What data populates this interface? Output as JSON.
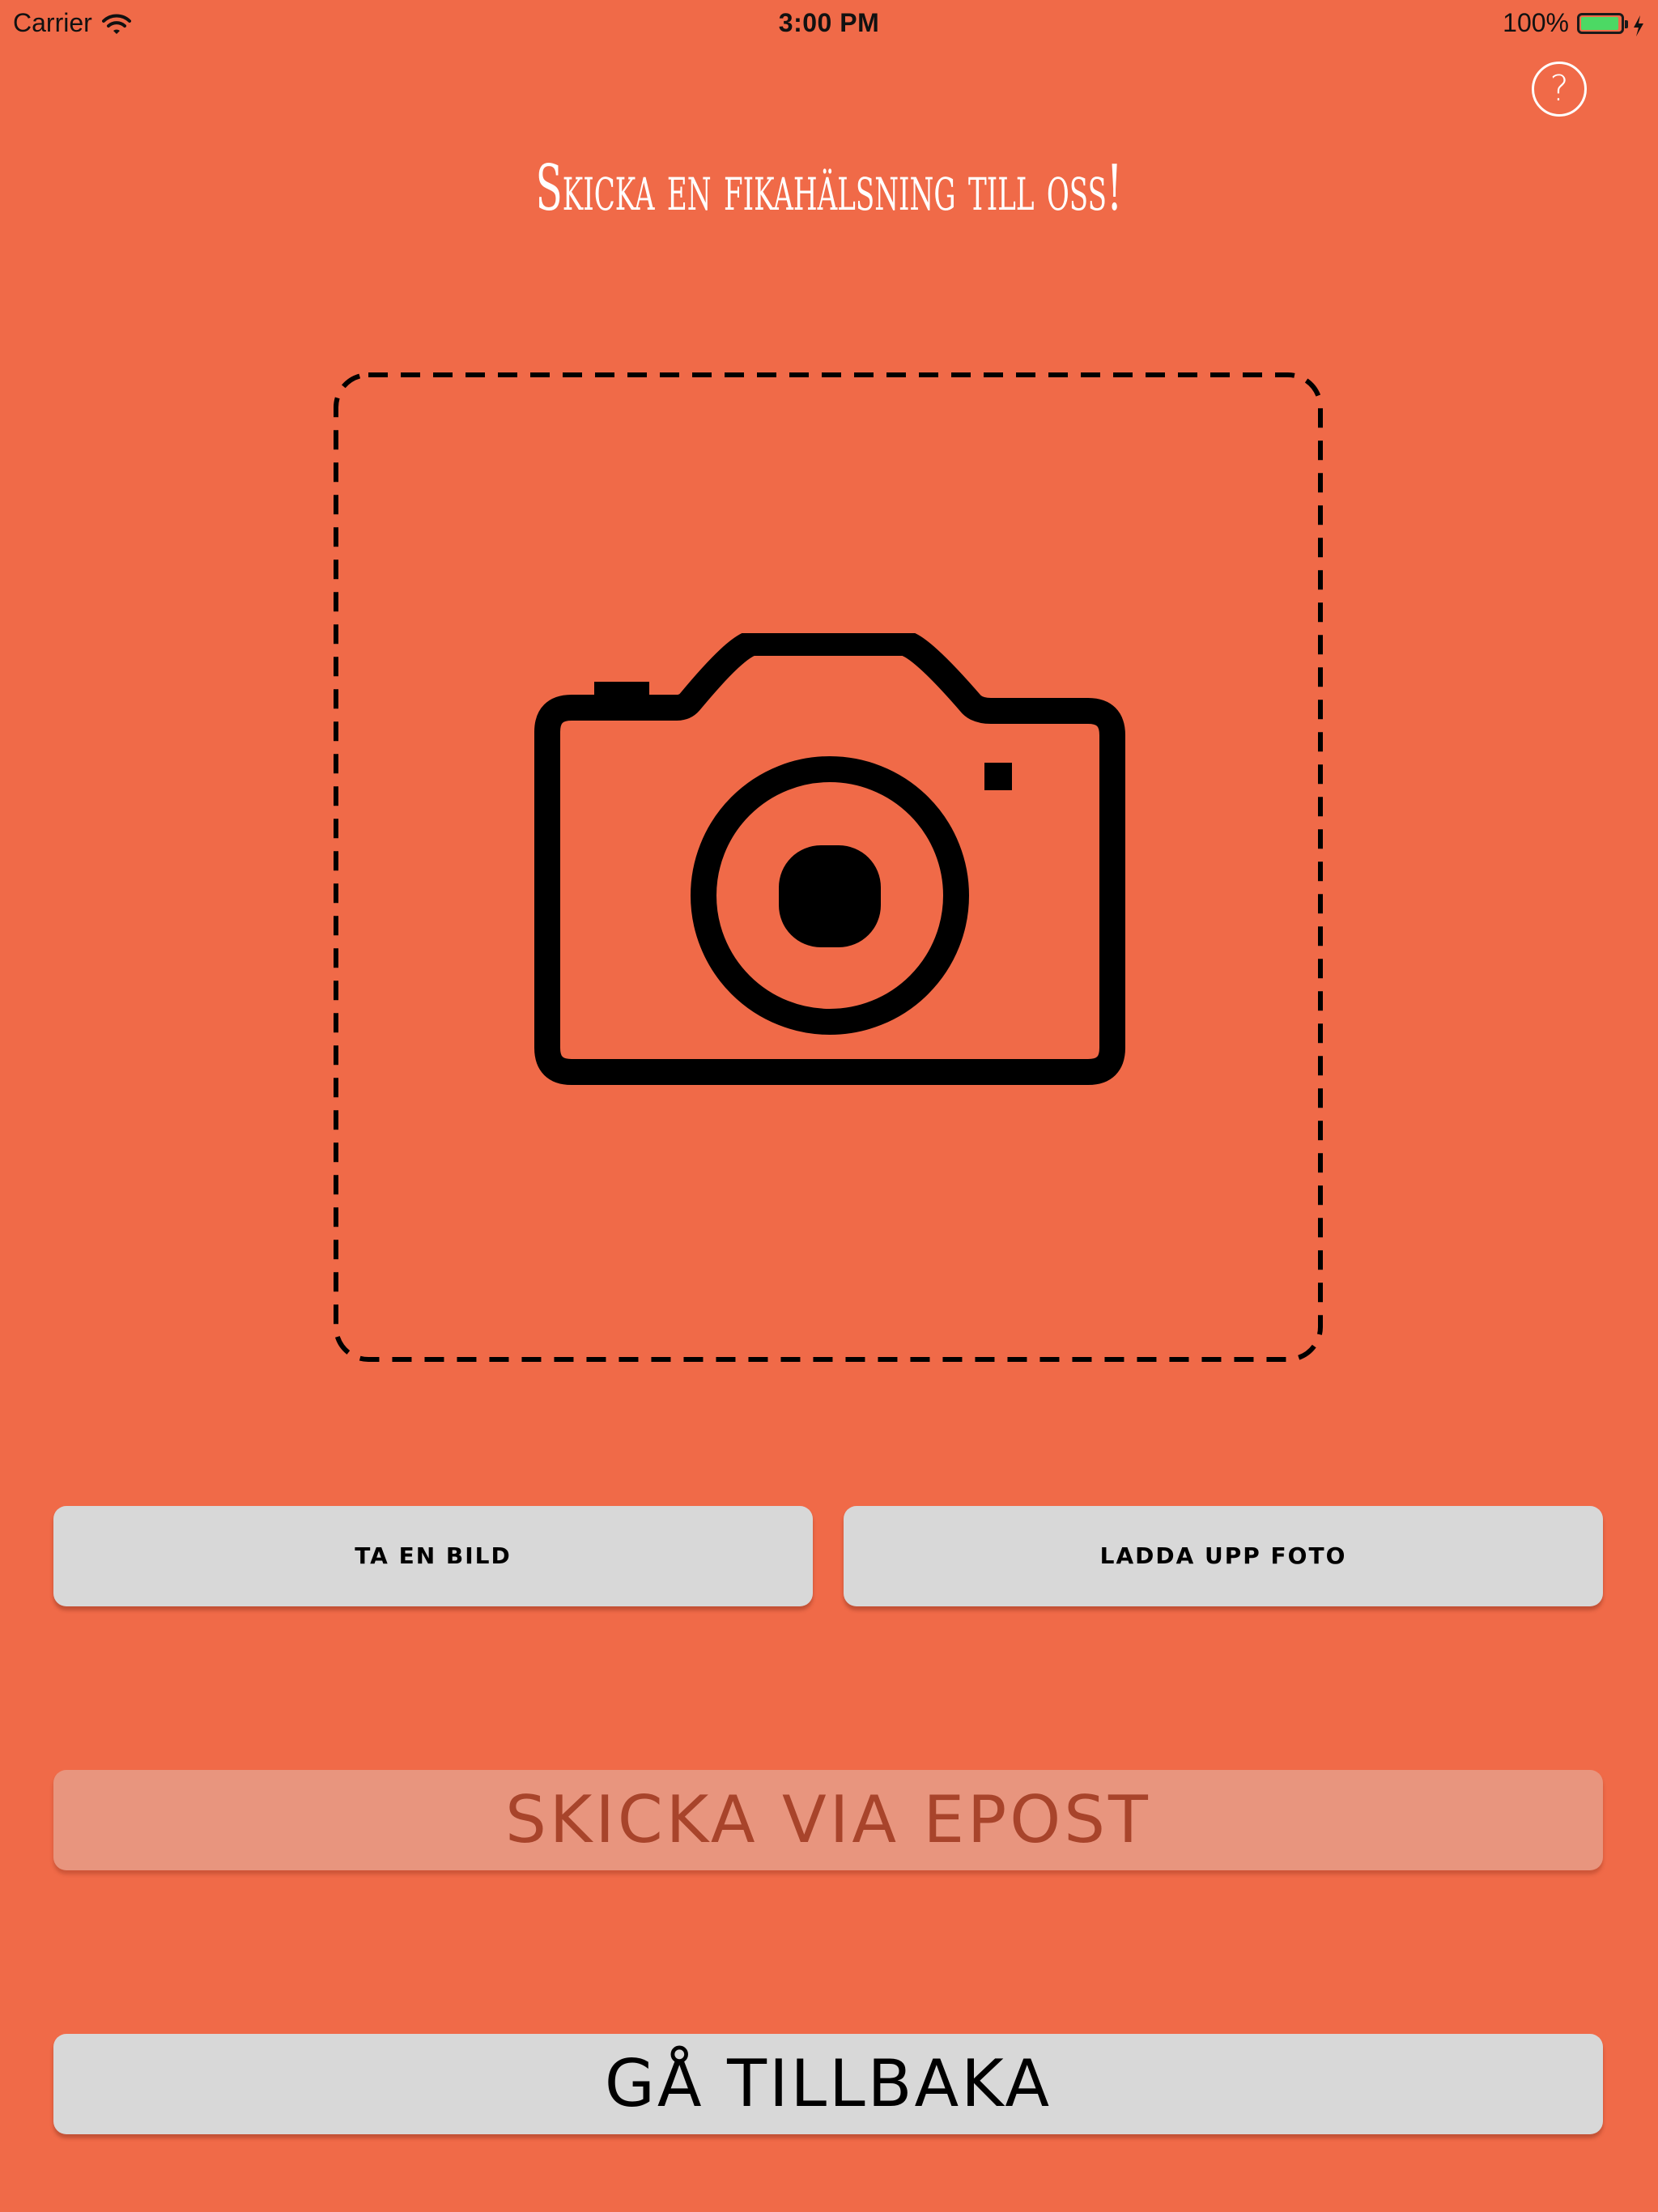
{
  "status_bar": {
    "carrier": "Carrier",
    "time": "3:00 PM",
    "battery_percent": "100%",
    "battery_level": 1.0,
    "icons": [
      "wifi-icon",
      "battery-icon",
      "charging-bolt-icon"
    ]
  },
  "help": {
    "label": "?",
    "icon": "help-circle-icon"
  },
  "header": {
    "title": "Skicka en fikahälsning till oss!"
  },
  "photo_area": {
    "icon": "camera-icon",
    "border_style": "dashed"
  },
  "actions": {
    "take_photo": "TA EN BILD",
    "upload_photo": "LADDA UPP FOTO",
    "send_email": "SKICKA VIA EPOST",
    "go_back": "GÅ TILLBAKA"
  },
  "colors": {
    "background": "#F06A48",
    "button": "#D8D8D8",
    "button_disabled": "#E8957E",
    "button_disabled_text": "#A8442B",
    "title_text": "#FFFFFF",
    "battery_fill": "#4CD964"
  }
}
